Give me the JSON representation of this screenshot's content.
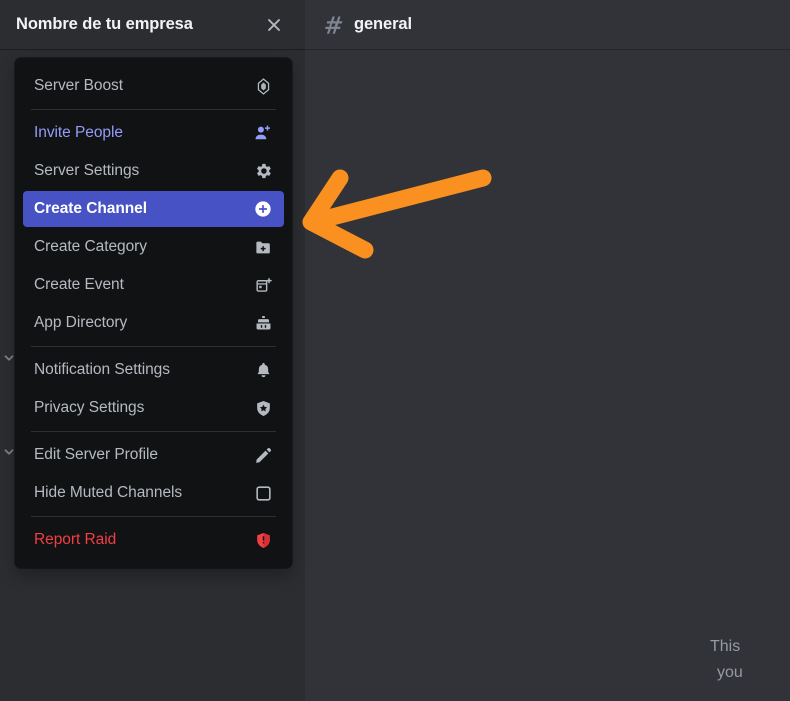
{
  "sidebar": {
    "server_name": "Nombre de tu empresa",
    "close_icon": "close-icon",
    "category_chevron_icon": "chevron-down-icon"
  },
  "main": {
    "channel_hash_icon": "hash-icon",
    "channel_name": "general",
    "welcome_text_line1": "This",
    "welcome_text_line2": "you"
  },
  "server_menu": {
    "groups": [
      {
        "items": [
          {
            "label": "Server Boost",
            "icon": "boost-gem-icon",
            "tone": "default",
            "selected": false
          }
        ]
      },
      {
        "items": [
          {
            "label": "Invite People",
            "icon": "person-add-icon",
            "tone": "brand",
            "selected": false
          },
          {
            "label": "Server Settings",
            "icon": "gear-icon",
            "tone": "default",
            "selected": false
          },
          {
            "label": "Create Channel",
            "icon": "circle-plus-icon",
            "tone": "default",
            "selected": true
          },
          {
            "label": "Create Category",
            "icon": "folder-plus-icon",
            "tone": "default",
            "selected": false
          },
          {
            "label": "Create Event",
            "icon": "calendar-plus-icon",
            "tone": "default",
            "selected": false
          },
          {
            "label": "App Directory",
            "icon": "robot-icon",
            "tone": "default",
            "selected": false
          }
        ]
      },
      {
        "items": [
          {
            "label": "Notification Settings",
            "icon": "bell-icon",
            "tone": "default",
            "selected": false
          },
          {
            "label": "Privacy Settings",
            "icon": "shield-star-icon",
            "tone": "default",
            "selected": false
          }
        ]
      },
      {
        "items": [
          {
            "label": "Edit Server Profile",
            "icon": "pencil-icon",
            "tone": "default",
            "selected": false
          },
          {
            "label": "Hide Muted Channels",
            "icon": "checkbox-empty-icon",
            "tone": "default",
            "selected": false
          }
        ]
      },
      {
        "items": [
          {
            "label": "Report Raid",
            "icon": "shield-danger-icon",
            "tone": "danger",
            "selected": false
          }
        ]
      }
    ]
  },
  "annotation": {
    "arrow_icon": "arrow-left-annotation",
    "arrow_color": "#f99020"
  },
  "colors": {
    "sidebar_bg": "#2b2d31",
    "main_bg": "#313338",
    "menu_bg": "#111214",
    "selected_bg": "#4752c4",
    "brand_text": "#949cf7",
    "danger_text": "#f23f43",
    "muted_text": "#b5bac1",
    "title_text": "#f2f3f5",
    "arrow": "#f99020"
  }
}
